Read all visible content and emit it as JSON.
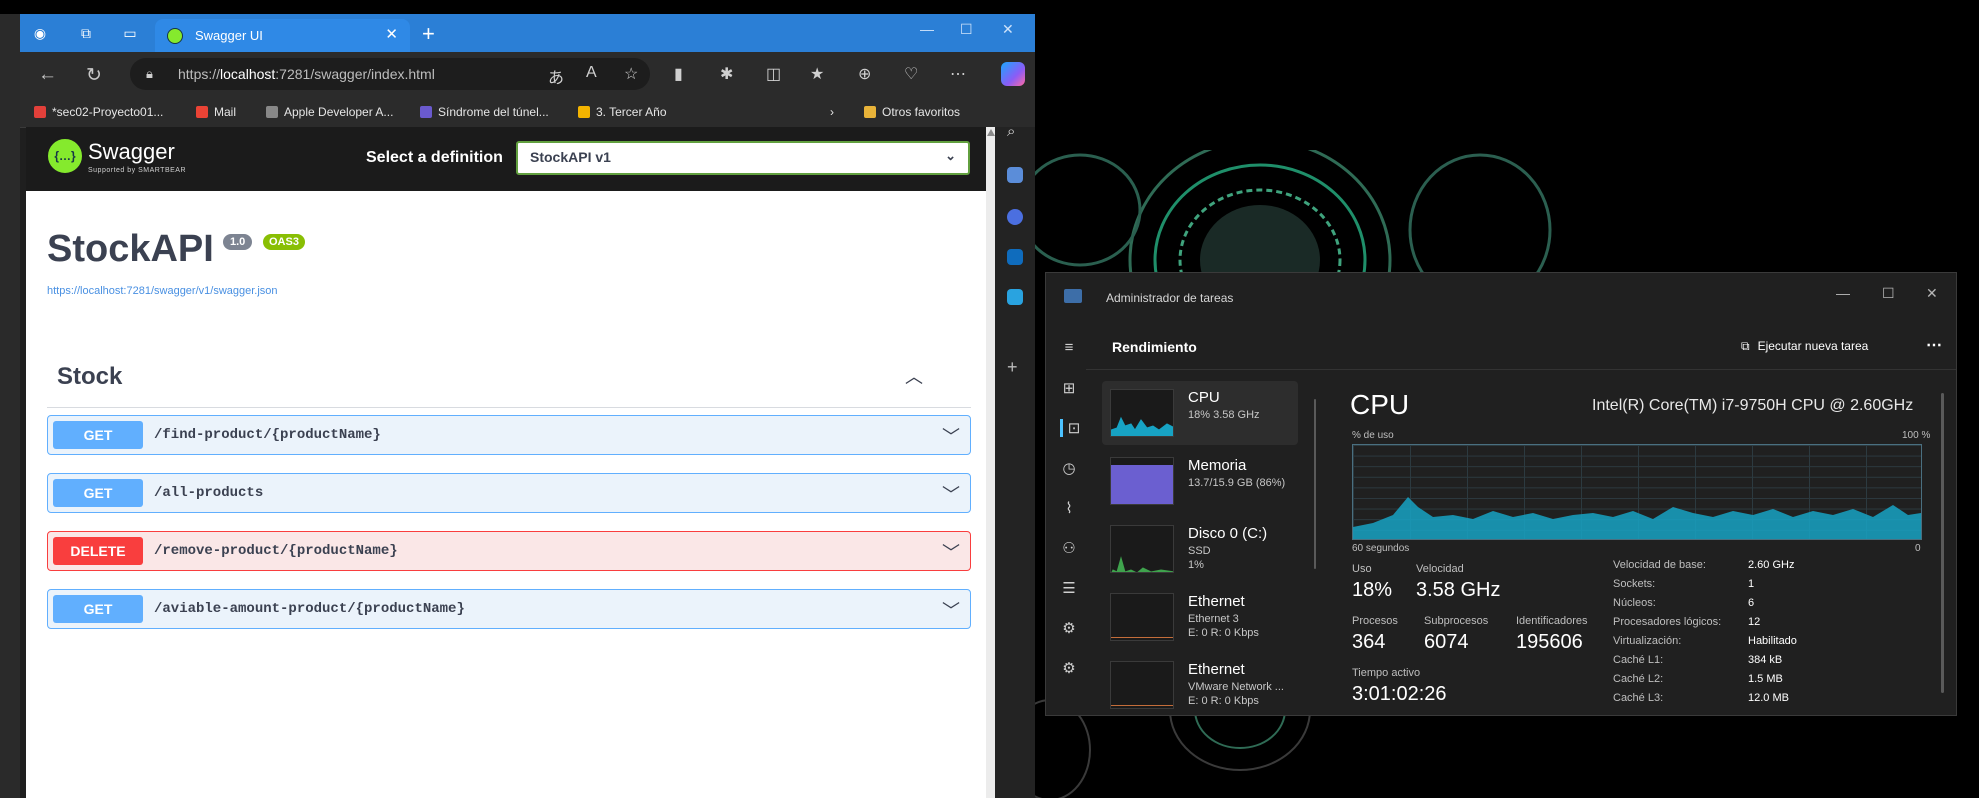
{
  "browser": {
    "tab_title": "Swagger UI",
    "url_prefix": "https://",
    "url_host": "localhost",
    "url_rest": ":7281/swagger/index.html",
    "bookmarks": [
      "*sec02-Proyecto01...",
      "Mail",
      "Apple Developer A...",
      "Síndrome del túnel...",
      "3. Tercer Año"
    ],
    "other_favorites": "Otros favoritos"
  },
  "swagger": {
    "brand": "Swagger",
    "brand_sub": "Supported by SMARTBEAR",
    "select_label": "Select a definition",
    "selected_definition": "StockAPI v1",
    "api_title": "StockAPI",
    "version_badge": "1.0",
    "oas_badge": "OAS3",
    "spec_url": "https://localhost:7281/swagger/v1/swagger.json",
    "tag": "Stock",
    "operations": [
      {
        "method": "GET",
        "path": "/find-product/{productName}"
      },
      {
        "method": "GET",
        "path": "/all-products"
      },
      {
        "method": "DELETE",
        "path": "/remove-product/{productName}"
      },
      {
        "method": "GET",
        "path": "/aviable-amount-product/{productName}"
      }
    ]
  },
  "taskmgr": {
    "title": "Administrador de tareas",
    "section": "Rendimiento",
    "run_task": "Ejecutar nueva tarea",
    "perf_items": [
      {
        "name": "CPU",
        "l1": "18% 3.58 GHz",
        "l2": ""
      },
      {
        "name": "Memoria",
        "l1": "13.7/15.9 GB (86%)",
        "l2": ""
      },
      {
        "name": "Disco 0 (C:)",
        "l1": "SSD",
        "l2": "1%"
      },
      {
        "name": "Ethernet",
        "l1": "Ethernet 3",
        "l2": "E: 0 R: 0 Kbps"
      },
      {
        "name": "Ethernet",
        "l1": "VMware Network ...",
        "l2": "E: 0 R: 0 Kbps"
      }
    ],
    "cpu": {
      "title": "CPU",
      "model": "Intel(R) Core(TM) i7-9750H CPU @ 2.60GHz",
      "usage_label": "% de uso",
      "usage_max": "100 %",
      "time_label": "60 segundos",
      "time_end": "0",
      "uso_label": "Uso",
      "uso": "18%",
      "vel_label": "Velocidad",
      "vel": "3.58 GHz",
      "proc_label": "Procesos",
      "proc": "364",
      "subproc_label": "Subprocesos",
      "subproc": "6074",
      "ident_label": "Identificadores",
      "ident": "195606",
      "uptime_label": "Tiempo activo",
      "uptime": "3:01:02:26",
      "specs": [
        {
          "k": "Velocidad de base:",
          "v": "2.60 GHz"
        },
        {
          "k": "Sockets:",
          "v": "1"
        },
        {
          "k": "Núcleos:",
          "v": "6"
        },
        {
          "k": "Procesadores lógicos:",
          "v": "12"
        },
        {
          "k": "Virtualización:",
          "v": "Habilitado"
        },
        {
          "k": "Caché L1:",
          "v": "384 kB"
        },
        {
          "k": "Caché L2:",
          "v": "1.5 MB"
        },
        {
          "k": "Caché L3:",
          "v": "12.0 MB"
        }
      ]
    }
  },
  "colors": {
    "get": "#61affe",
    "delete": "#f93e3e",
    "swagger_green": "#85ea2d",
    "edge_blue": "#2b7fd6",
    "cpu_graph": "#17a3c4"
  }
}
